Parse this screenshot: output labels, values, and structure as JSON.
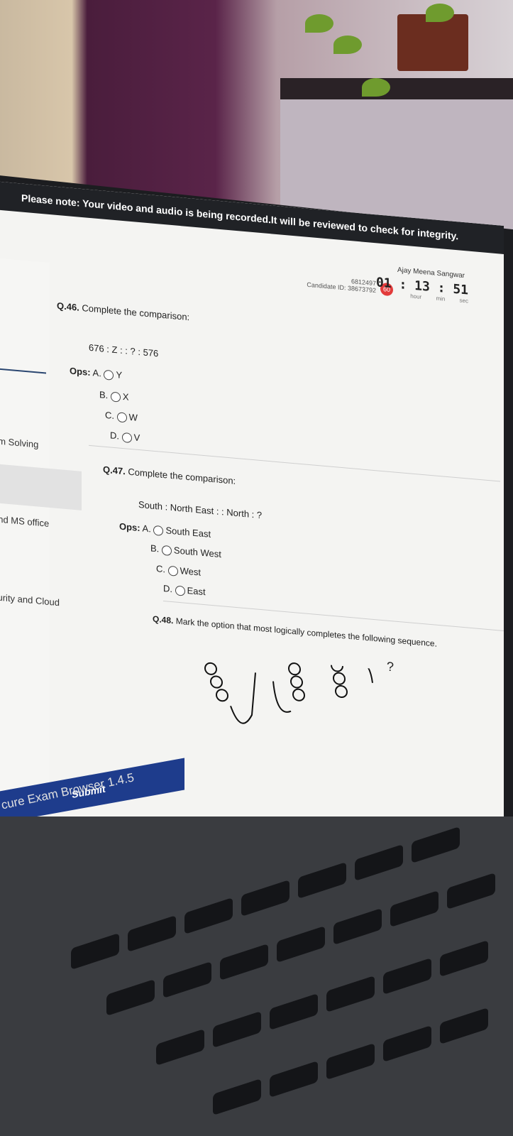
{
  "notice": "Please note: Your video and audio is being recorded.It will be reviewed to check for integrity.",
  "candidate": {
    "name": "Ajay Meena Sangwar",
    "id_line_1": "6812497",
    "id_line_2": "Candidate ID: 38673792",
    "badge": "60"
  },
  "timer": {
    "value": "01 : 13 : 51",
    "units": "hour min sec"
  },
  "sidebar": {
    "items": [
      {
        "label": "em Solving"
      },
      {
        "label": "and MS office"
      },
      {
        "label": "curity and Cloud"
      }
    ]
  },
  "questions": [
    {
      "number": "Q.46.",
      "text": "Complete the comparison:",
      "prompt": "676 : Z : : ? : 576",
      "ops_label": "Ops:",
      "options": [
        {
          "letter": "A.",
          "text": "Y"
        },
        {
          "letter": "B.",
          "text": "X"
        },
        {
          "letter": "C.",
          "text": "W"
        },
        {
          "letter": "D.",
          "text": "V"
        }
      ]
    },
    {
      "number": "Q.47.",
      "text": "Complete the comparison:",
      "prompt": "South : North East : : North : ?",
      "ops_label": "Ops:",
      "options": [
        {
          "letter": "A.",
          "text": "South East"
        },
        {
          "letter": "B.",
          "text": "South West"
        },
        {
          "letter": "C.",
          "text": "West"
        },
        {
          "letter": "D.",
          "text": "East"
        }
      ]
    },
    {
      "number": "Q.48.",
      "text": "Mark the option that most logically completes the following sequence.",
      "question_mark": "?"
    }
  ],
  "submit_label": "Submit",
  "app_name": "cure Exam Browser 1.4.5"
}
